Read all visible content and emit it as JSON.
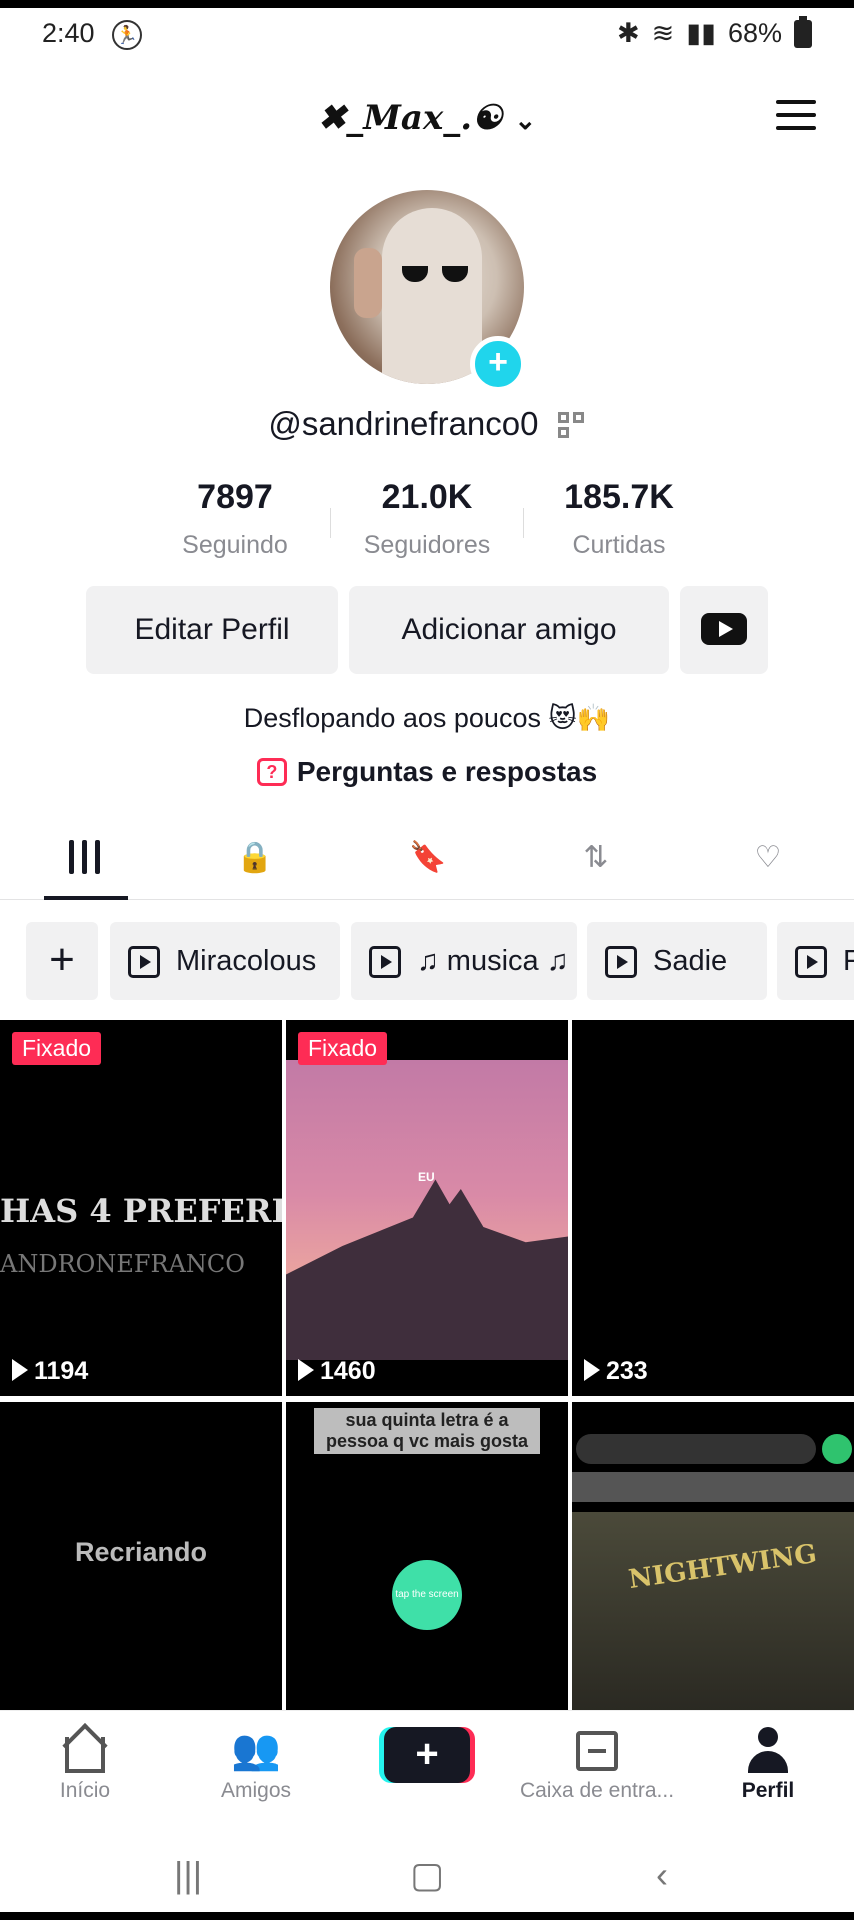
{
  "status": {
    "time": "2:40",
    "battery": "68%"
  },
  "header": {
    "username": "✖_Max_.☯",
    "chevron": "⌄"
  },
  "profile": {
    "handle": "@sandrinefranco0",
    "stats": [
      {
        "value": "7897",
        "label": "Seguindo"
      },
      {
        "value": "21.0K",
        "label": "Seguidores"
      },
      {
        "value": "185.7K",
        "label": "Curtidas"
      }
    ],
    "buttons": {
      "edit": "Editar Perfil",
      "add_friend": "Adicionar amigo"
    },
    "bio": "Desflopando aos poucos 😻🙌",
    "qa": "Perguntas e respostas"
  },
  "playlists": [
    "Miracolous",
    "♫ musica ♫",
    "Sadie",
    "F"
  ],
  "videos": [
    {
      "pinned": "Fixado",
      "views": "1194",
      "caption": "HAS 4 PREFERI",
      "sub": "ANDRONEFRANCO"
    },
    {
      "pinned": "Fixado",
      "views": "1460",
      "overlay": "EU"
    },
    {
      "views": "233"
    },
    {
      "overlay": "Recriando"
    },
    {
      "overlay": "sua quinta letra é a pessoa q vc mais gosta",
      "tap": "tap the screen"
    },
    {
      "overlay": "NIGHTWING"
    }
  ],
  "bottom_nav": [
    {
      "label": "Início"
    },
    {
      "label": "Amigos"
    },
    {
      "label": "+"
    },
    {
      "label": "Caixa de entra..."
    },
    {
      "label": "Perfil"
    }
  ],
  "colors": {
    "accent": "#fe2c55",
    "cyan": "#25f4ee",
    "badge": "#20d5ec"
  }
}
